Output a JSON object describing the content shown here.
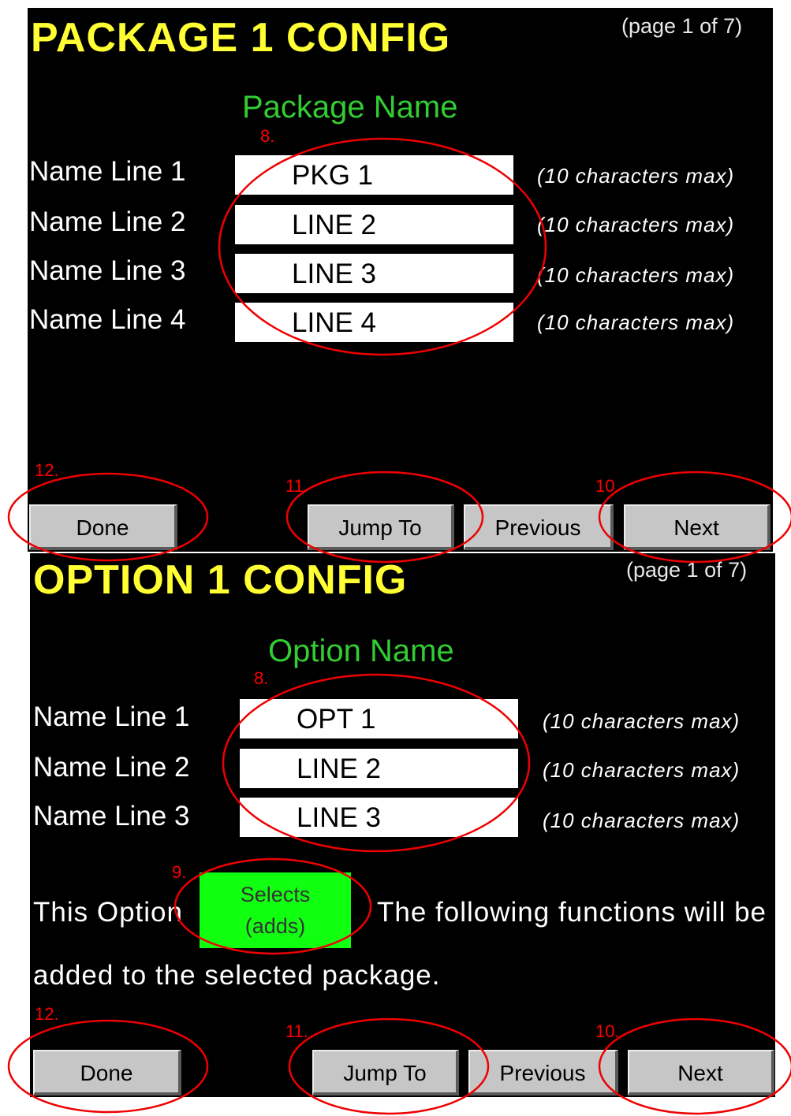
{
  "package_panel": {
    "title": "PACKAGE 1 CONFIG",
    "page_indicator": "(page 1 of 7)",
    "section_heading": "Package Name",
    "rows": [
      {
        "label": "Name Line 1",
        "value": "PKG 1",
        "hint": "(10 characters max)"
      },
      {
        "label": "Name Line 2",
        "value": "LINE 2",
        "hint": "(10 characters max)"
      },
      {
        "label": "Name Line 3",
        "value": "LINE 3",
        "hint": "(10 characters max)"
      },
      {
        "label": "Name Line 4",
        "value": "LINE 4",
        "hint": "(10 characters max)"
      }
    ],
    "buttons": {
      "done": "Done",
      "jump_to": "Jump To",
      "previous": "Previous",
      "next": "Next"
    }
  },
  "option_panel": {
    "title": "OPTION 1 CONFIG",
    "page_indicator": "(page 1 of 7)",
    "section_heading": "Option Name",
    "rows": [
      {
        "label": "Name Line 1",
        "value": "OPT 1",
        "hint": "(10 characters max)"
      },
      {
        "label": "Name Line 2",
        "value": "LINE 2",
        "hint": "(10 characters max)"
      },
      {
        "label": "Name Line 3",
        "value": "LINE 3",
        "hint": "(10 characters max)"
      }
    ],
    "option_prefix": "This Option",
    "mode_button_line1": "Selects",
    "mode_button_line2": "(adds)",
    "option_suffix": "The following functions will be",
    "option_suffix_line2": "added to the selected package.",
    "buttons": {
      "done": "Done",
      "jump_to": "Jump To",
      "previous": "Previous",
      "next": "Next"
    }
  },
  "callouts": {
    "name_fields": "8.",
    "mode_button": "9.",
    "next": "10.",
    "jump_to": "11.",
    "done": "12."
  },
  "colors": {
    "title": "#ffff33",
    "heading": "#33cc33",
    "mode_button": "#11ff11",
    "callout": "#ff0000"
  }
}
